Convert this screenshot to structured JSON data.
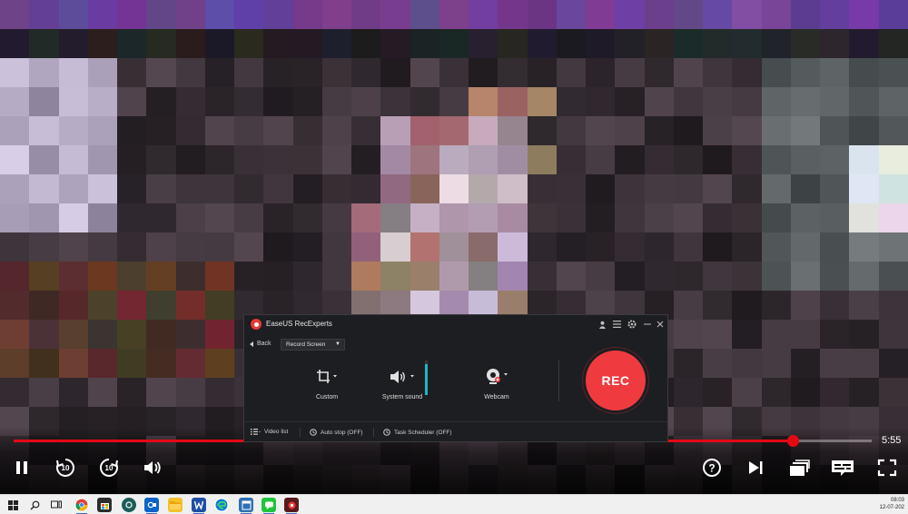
{
  "video_player": {
    "time_remaining": "5:55",
    "progress_fraction": 0.908,
    "accent_color": "#e50914",
    "controls": [
      "pause-icon",
      "rewind-10-icon",
      "forward-10-icon",
      "volume-icon",
      "help-icon",
      "next-episode-icon",
      "episodes-icon",
      "subtitles-icon",
      "fullscreen-icon"
    ],
    "rewind_label": "10",
    "forward_label": "10"
  },
  "recorder": {
    "title": "EaseUS RecExperts",
    "back_label": "Back",
    "mode_label": "Record Screen",
    "options": {
      "custom": "Custom",
      "system_sound": "System sound",
      "webcam": "Webcam"
    },
    "system_sound_level": 0.9,
    "rec_label": "REC",
    "rec_color": "#ef3b40",
    "footer": {
      "video_list": "Video list",
      "auto_stop": "Auto stop (OFF)",
      "task_scheduler": "Task Scheduler (OFF)"
    }
  },
  "taskbar": {
    "time": "08:03",
    "date": "12-07-202"
  }
}
